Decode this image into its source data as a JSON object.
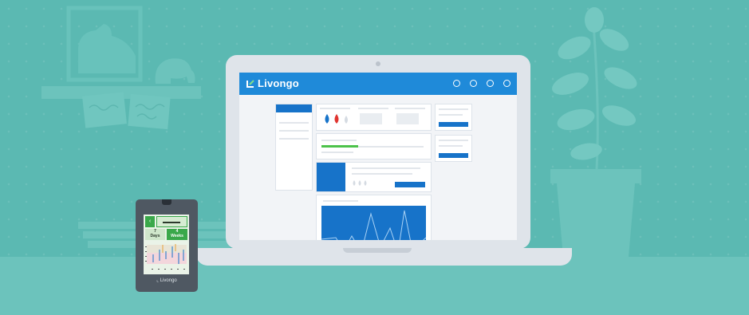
{
  "app": {
    "brand": "Livongo",
    "nav_items": [
      "",
      "",
      "",
      ""
    ]
  },
  "meter": {
    "left_value": "7",
    "left_unit": "Days",
    "right_value": "4",
    "right_unit": "Weeks",
    "brand": "Livongo"
  },
  "colors": {
    "background": "#5bb9b2",
    "app_bar": "#1f8ad9",
    "accent_blue": "#1773c9",
    "progress_green": "#4cc24a",
    "drop_red": "#e0342f"
  }
}
